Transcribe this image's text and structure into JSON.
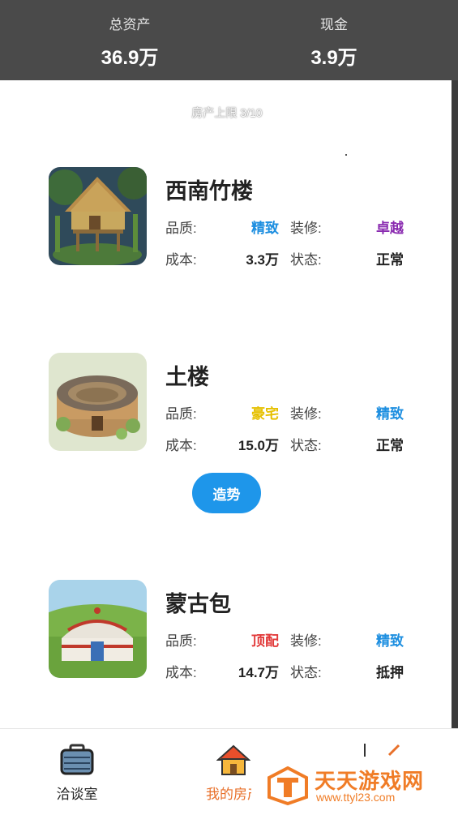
{
  "header": {
    "total_assets_label": "总资产",
    "total_assets_value": "36.9万",
    "cash_label": "现金",
    "cash_value": "3.9万"
  },
  "property_limit": "房产上限 3/10",
  "properties": [
    {
      "name": "西南竹楼",
      "quality_label": "品质:",
      "quality": "精致",
      "quality_color": "#1e8fe0",
      "deco_label": "装修:",
      "deco": "卓越",
      "deco_color": "#8a2bb0",
      "cost_label": "成本:",
      "cost": "3.3万",
      "status_label": "状态:",
      "status": "正常"
    },
    {
      "name": "土楼",
      "quality_label": "品质:",
      "quality": "豪宅",
      "quality_color": "#e6c000",
      "deco_label": "装修:",
      "deco": "精致",
      "deco_color": "#1e8fe0",
      "cost_label": "成本:",
      "cost": "15.0万",
      "status_label": "状态:",
      "status": "正常"
    },
    {
      "name": "蒙古包",
      "quality_label": "品质:",
      "quality": "顶配",
      "quality_color": "#e23b3b",
      "deco_label": "装修:",
      "deco": "精致",
      "deco_color": "#1e8fe0",
      "cost_label": "成本:",
      "cost": "14.7万",
      "status_label": "状态:",
      "status": "抵押"
    }
  ],
  "promo_button": "造势",
  "tabs": [
    {
      "label": "洽谈室",
      "icon": "briefcase-icon"
    },
    {
      "label": "我的房产",
      "icon": "house-icon"
    }
  ],
  "watermark": {
    "title": "天天游戏网",
    "url": "www.ttyl23.com"
  }
}
